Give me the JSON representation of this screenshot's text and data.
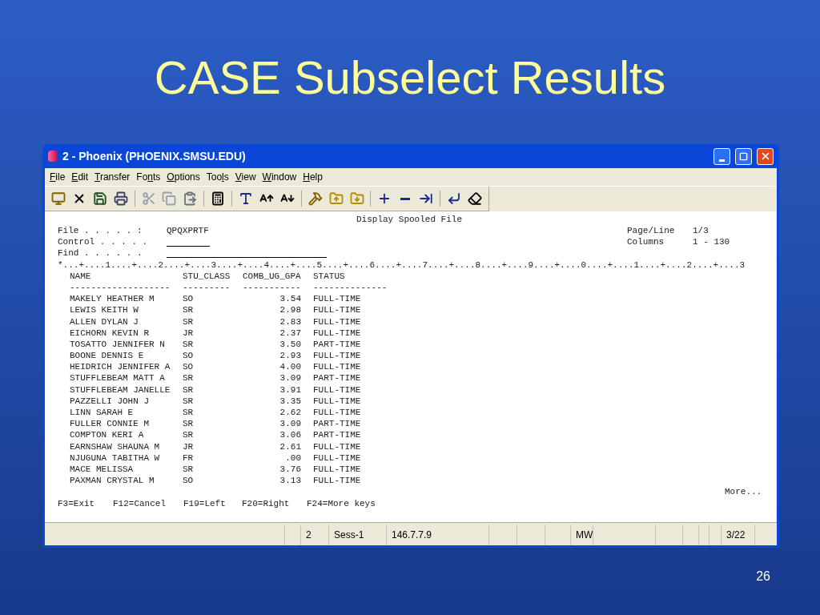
{
  "slide": {
    "title": "CASE Subselect Results",
    "page_number": "26"
  },
  "window": {
    "title": "2 - Phoenix (PHOENIX.SMSU.EDU)"
  },
  "menu": [
    {
      "key": "F",
      "post": "ile"
    },
    {
      "key": "E",
      "post": "dit"
    },
    {
      "key": "T",
      "post": "ransfer"
    },
    {
      "pre": "Fo",
      "key": "n",
      "post": "ts"
    },
    {
      "key": "O",
      "post": "ptions"
    },
    {
      "pre": "Too",
      "key": "l",
      "post": "s"
    },
    {
      "key": "V",
      "post": "iew"
    },
    {
      "key": "W",
      "post": "indow"
    },
    {
      "key": "H",
      "post": "elp"
    }
  ],
  "terminal": {
    "screen_title": "Display Spooled File",
    "file_label": "File . . . . . :",
    "file_value": "QPQXPRTF",
    "control_label": "Control . . . . .",
    "find_label": "Find . . . . . .",
    "page_line_label": "Page/Line",
    "page_line_value": "1/3",
    "columns_label": "Columns",
    "columns_value": "1 - 130",
    "ruler": "*...+....1....+....2....+....3....+....4....+....5....+....6....+....7....+....8....+....9....+....0....+....1....+....2....+....3",
    "columns": [
      {
        "heading": "NAME",
        "rule": "-------------------"
      },
      {
        "heading": "STU_CLASS",
        "rule": "---------"
      },
      {
        "heading": "COMB_UG_GPA",
        "rule": "-----------"
      },
      {
        "heading": "STATUS",
        "rule": "--------------"
      }
    ],
    "rows": [
      [
        "MAKELY HEATHER M",
        "SO",
        "3.54",
        "FULL-TIME"
      ],
      [
        "LEWIS KEITH W",
        "SR",
        "2.98",
        "FULL-TIME"
      ],
      [
        "ALLEN DYLAN J",
        "SR",
        "2.83",
        "FULL-TIME"
      ],
      [
        "EICHORN KEVIN R",
        "JR",
        "2.37",
        "FULL-TIME"
      ],
      [
        "TOSATTO JENNIFER N",
        "SR",
        "3.50",
        "PART-TIME"
      ],
      [
        "BOONE DENNIS E",
        "SO",
        "2.93",
        "FULL-TIME"
      ],
      [
        "HEIDRICH JENNIFER A",
        "SO",
        "4.00",
        "FULL-TIME"
      ],
      [
        "STUFFLEBEAM MATT A",
        "SR",
        "3.09",
        "PART-TIME"
      ],
      [
        "STUFFLEBEAM JANELLE",
        "SR",
        "3.91",
        "FULL-TIME"
      ],
      [
        "PAZZELLI JOHN J",
        "SR",
        "3.35",
        "FULL-TIME"
      ],
      [
        "LINN SARAH E",
        "SR",
        "2.62",
        "FULL-TIME"
      ],
      [
        "FULLER CONNIE M",
        "SR",
        "3.09",
        "PART-TIME"
      ],
      [
        "COMPTON KERI A",
        "SR",
        "3.06",
        "PART-TIME"
      ],
      [
        "EARNSHAW SHAUNA M",
        "JR",
        "2.61",
        "FULL-TIME"
      ],
      [
        "NJUGUNA TABITHA W",
        "FR",
        ".00",
        "FULL-TIME"
      ],
      [
        "MACE MELISSA",
        "SR",
        "3.76",
        "FULL-TIME"
      ],
      [
        "PAXMAN CRYSTAL M",
        "SO",
        "3.13",
        "FULL-TIME"
      ]
    ],
    "more": "More...",
    "function_keys": [
      "F3=Exit",
      "F12=Cancel",
      "F19=Left",
      "F20=Right",
      "F24=More keys"
    ]
  },
  "status_bar": [
    "2",
    "Sess-1",
    "146.7.7.9",
    "MW",
    "3/22"
  ]
}
